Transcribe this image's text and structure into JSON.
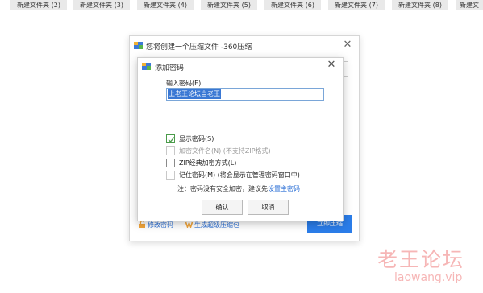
{
  "folder_tabs": [
    "新建文件夹 (2)",
    "新建文件夹 (3)",
    "新建文件夹 (4)",
    "新建文件夹 (5)",
    "新建文件夹 (6)",
    "新建文件夹 (7)",
    "新建文件夹 (8)",
    "新建文"
  ],
  "main_window": {
    "title": "您将创建一个压缩文件 -360压缩",
    "bg_label": "压",
    "modify_password_link": "修改密码",
    "gen_package_link": "生成超级压缩包",
    "compress_button": "立即压缩"
  },
  "password_dialog": {
    "title": "添加密码",
    "input_label": "输入密码(E)",
    "password_value": "上老王论坛当老王",
    "options": [
      {
        "label": "显示密码(S)",
        "checked": true,
        "disabled": false
      },
      {
        "label": "加密文件名(N) (不支持ZIP格式)",
        "checked": false,
        "disabled": true
      },
      {
        "label": "ZIP经典加密方式(L)",
        "checked": false,
        "disabled": false
      },
      {
        "label": "记住密码(M) (将会显示在管理密码窗口中)",
        "checked": false,
        "disabled": false
      }
    ],
    "note_prefix": "注：密码没有安全加密，建议先",
    "note_link": "设置主密码",
    "ok_button": "确认",
    "cancel_button": "取消"
  },
  "watermark": {
    "text": "老王论坛",
    "url": "laowang.vip"
  },
  "colors": {
    "accent": "#2b7de9",
    "link": "#2b6fd6",
    "selection": "#3a78d4",
    "check": "#4a9b4a",
    "watermark": "#f07b7b"
  }
}
